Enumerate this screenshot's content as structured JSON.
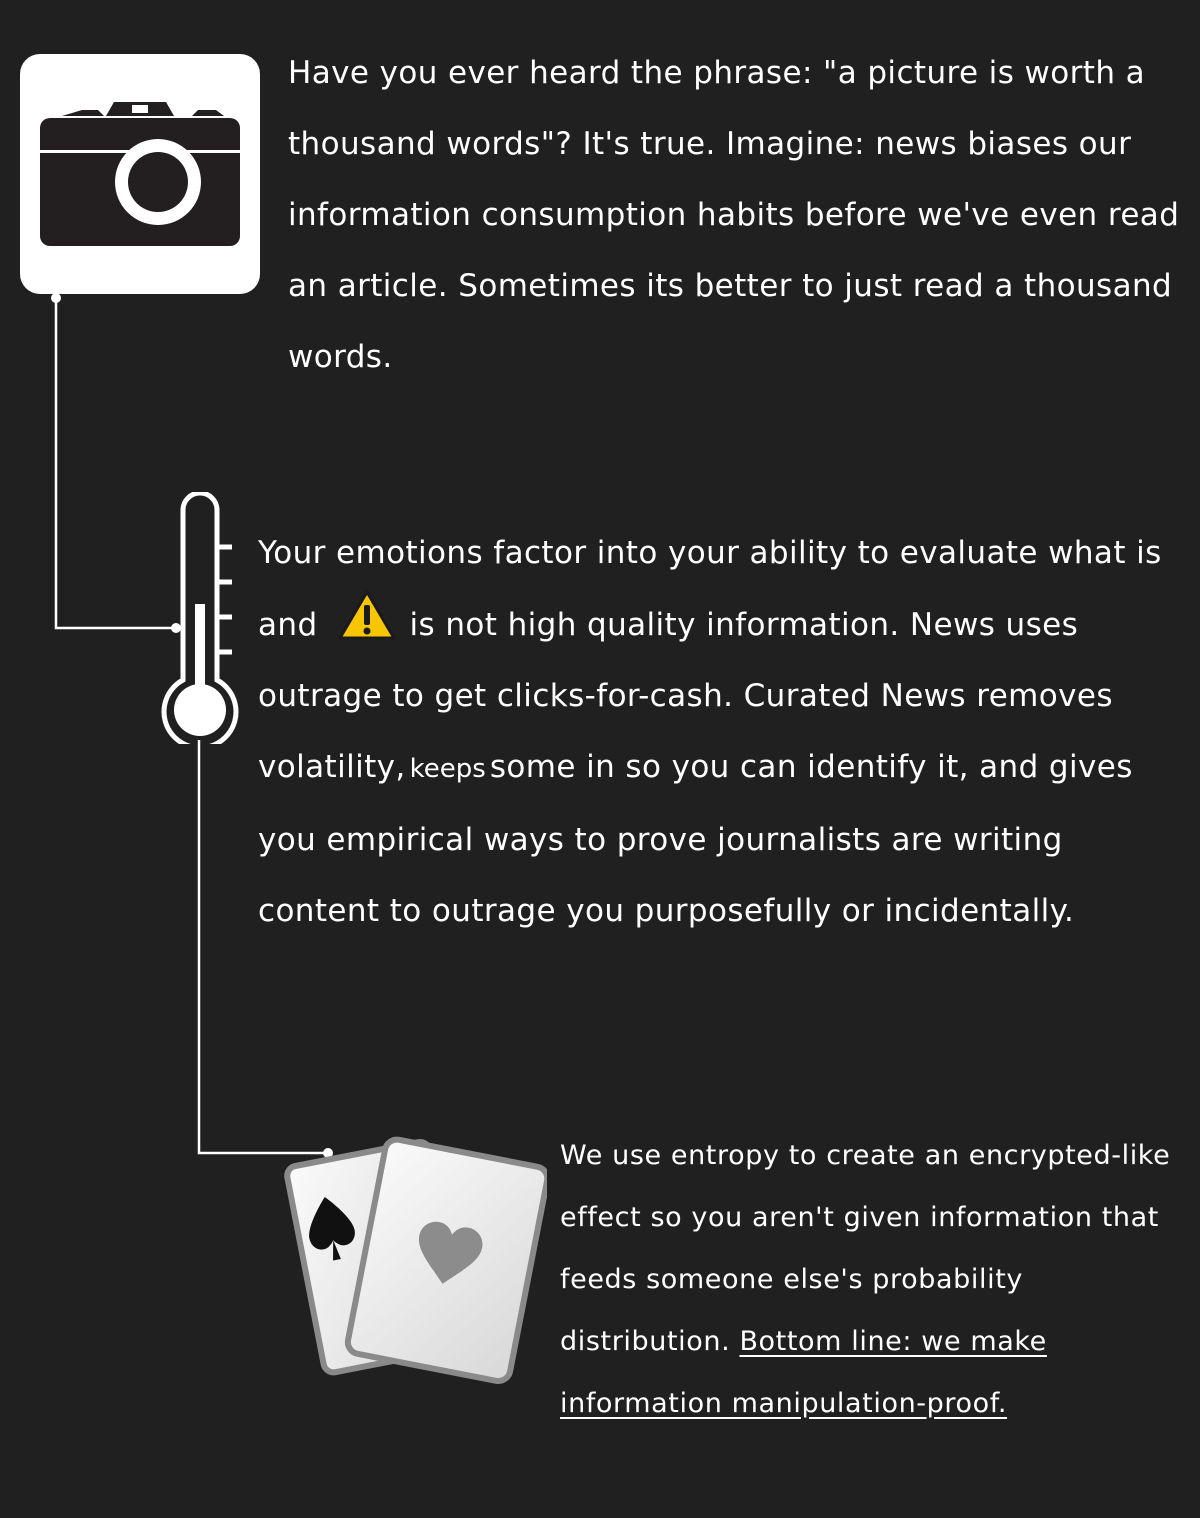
{
  "sections": [
    {
      "icon": "camera-icon",
      "text": "Have you ever heard the phrase: \"a picture is worth a thousand words\"? It's true. Imagine: news biases our information consumption habits before we've even read an article. Sometimes its better to just read a thousand words."
    },
    {
      "icon": "thermometer-icon",
      "text_before_icon": "Your emotions factor into your ability to evaluate what is and",
      "inline_icon": "warning-icon",
      "text_after_icon": "is not high quality information. News uses outrage to get clicks-for-cash. Curated News removes volatility,",
      "small_word": "keeps",
      "text_end": "some in so you can identify it, and gives you empirical ways to prove journalists are writing content to outrage you purposefully or incidentally."
    },
    {
      "icon": "playing-cards-icon",
      "text": "We use entropy to create an encrypted-like effect so you aren't given information that feeds someone else's probability distribution.",
      "underlined_text": "Bottom line: we make information manipulation-proof."
    }
  ],
  "colors": {
    "background": "#202020",
    "text": "#ffffff",
    "warning": "#f7c600",
    "card_gray": "#8a8a8a"
  }
}
